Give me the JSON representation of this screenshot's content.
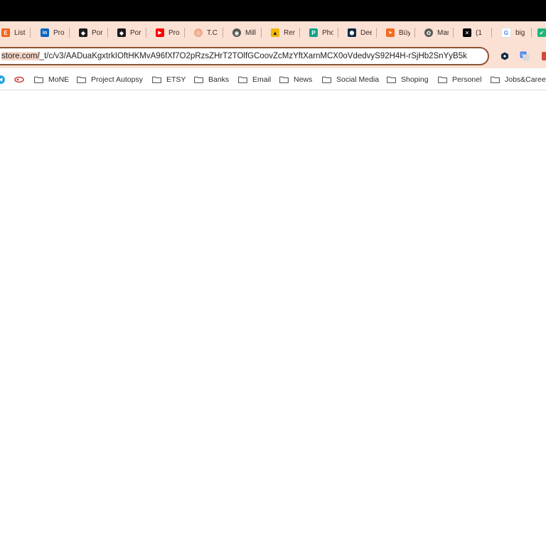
{
  "tabs": [
    {
      "icon": "etsy-icon",
      "label": "List",
      "color": "#f1641e",
      "glyph": "E"
    },
    {
      "icon": "linkedin-icon",
      "label": "Pro",
      "color": "#0a66c2",
      "glyph": "in"
    },
    {
      "icon": "portal-icon",
      "label": "Por",
      "color": "#1b1b1b",
      "glyph": "◆"
    },
    {
      "icon": "portal-icon",
      "label": "Por",
      "color": "#1b1b1b",
      "glyph": "◆"
    },
    {
      "icon": "youtube-icon",
      "label": "Pro",
      "color": "#ff0000",
      "glyph": "▶"
    },
    {
      "icon": "face-icon",
      "label": "T.C",
      "color": "#f1a98c",
      "glyph": "☺"
    },
    {
      "icon": "globe-icon",
      "label": "Mill",
      "color": "#555555",
      "glyph": "◉"
    },
    {
      "icon": "graduation-icon",
      "label": "Ren",
      "color": "#f2b705",
      "glyph": "▲"
    },
    {
      "icon": "p-icon",
      "label": "Pho",
      "color": "#14a38b",
      "glyph": "P"
    },
    {
      "icon": "deepl-icon",
      "label": "Dee",
      "color": "#0f2b46",
      "glyph": "⬢"
    },
    {
      "icon": "arrow-icon",
      "label": "Büy",
      "color": "#f46b1f",
      "glyph": "➤"
    },
    {
      "icon": "openai-icon",
      "label": "Mar",
      "color": "#5a5a5a",
      "glyph": "✿"
    },
    {
      "icon": "capcut-icon",
      "label": "(1",
      "color": "#000000",
      "glyph": "✕"
    },
    {
      "icon": "google-icon",
      "label": "big",
      "color": "#4285f4",
      "glyph": "G"
    },
    {
      "icon": "check-icon",
      "label": "",
      "color": "#1fb57a",
      "glyph": "✔"
    }
  ],
  "address_bar": {
    "url_highlight": "store.com/",
    "url_rest": "_t/c/v3/AADuaKgxtrkIOftHKMvA96fXf7O2pRzsZHrT2TOlfGCoovZcMzYftXarnMCX0oVdedvyS92H4H-rSjHb2SnYyB5k"
  },
  "extensions": [
    {
      "icon": "deepl-extension-icon",
      "color": "#0f2b46"
    },
    {
      "icon": "translate-extension-icon",
      "color": "#4285f4"
    },
    {
      "icon": "extension-icon",
      "color": "#d34a3a"
    }
  ],
  "bookmarks": [
    {
      "icon": "telegram-icon",
      "label": ""
    },
    {
      "icon": "hookah-icon",
      "label": ""
    },
    {
      "icon": "folder-icon",
      "label": "MoNE"
    },
    {
      "icon": "folder-icon",
      "label": "Project Autopsy"
    },
    {
      "icon": "folder-icon",
      "label": "ETSY"
    },
    {
      "icon": "folder-icon",
      "label": "Banks"
    },
    {
      "icon": "folder-icon",
      "label": "Email"
    },
    {
      "icon": "folder-icon",
      "label": "News"
    },
    {
      "icon": "folder-icon",
      "label": "Social Media"
    },
    {
      "icon": "folder-icon",
      "label": "Shoping"
    },
    {
      "icon": "folder-icon",
      "label": "Personel"
    },
    {
      "icon": "folder-icon",
      "label": "Jobs&Career"
    }
  ]
}
